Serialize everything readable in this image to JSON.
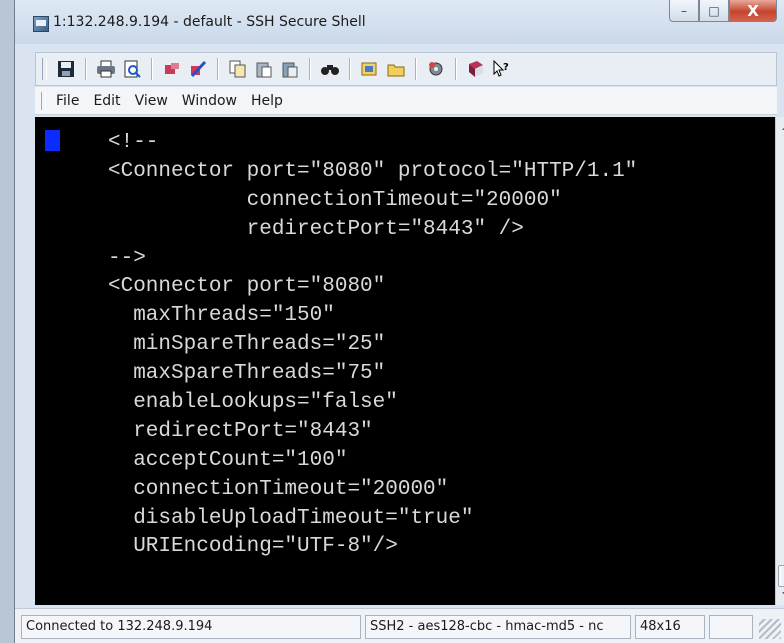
{
  "window": {
    "title": "1:132.248.9.194 - default - SSH Secure Shell",
    "controls": {
      "minimize": "–",
      "maximize": "□",
      "close": "X"
    }
  },
  "toolbar": {
    "icons": [
      "save-icon",
      "print-icon",
      "print-preview-icon",
      "connect-icon",
      "disconnect-icon",
      "copy-icon",
      "paste-icon",
      "paste-special-icon",
      "find-icon",
      "profile-icon",
      "open-folder-icon",
      "settings-icon",
      "help-book-icon",
      "context-help-icon"
    ]
  },
  "menu": {
    "items": [
      {
        "label": "File"
      },
      {
        "label": "Edit"
      },
      {
        "label": "View"
      },
      {
        "label": "Window"
      },
      {
        "label": "Help"
      }
    ]
  },
  "terminal": {
    "lines": [
      "<!--",
      "<Connector port=\"8080\" protocol=\"HTTP/1.1\"",
      "           connectionTimeout=\"20000\"",
      "           redirectPort=\"8443\" />",
      "-->",
      "<Connector port=\"8080\"",
      "  maxThreads=\"150\"",
      "  minSpareThreads=\"25\"",
      "  maxSpareThreads=\"75\"",
      "  enableLookups=\"false\"",
      "  redirectPort=\"8443\"",
      "  acceptCount=\"100\"",
      "  connectionTimeout=\"20000\"",
      "  disableUploadTimeout=\"true\"",
      "  URIEncoding=\"UTF-8\"/>"
    ],
    "colors": {
      "background": "#000000",
      "text": "#d9d9d9",
      "cursor": "#0a2cff"
    }
  },
  "status": {
    "connection": "Connected to 132.248.9.194",
    "cipher": "SSH2 - aes128-cbc - hmac-md5 - nc",
    "size": "48x16"
  }
}
